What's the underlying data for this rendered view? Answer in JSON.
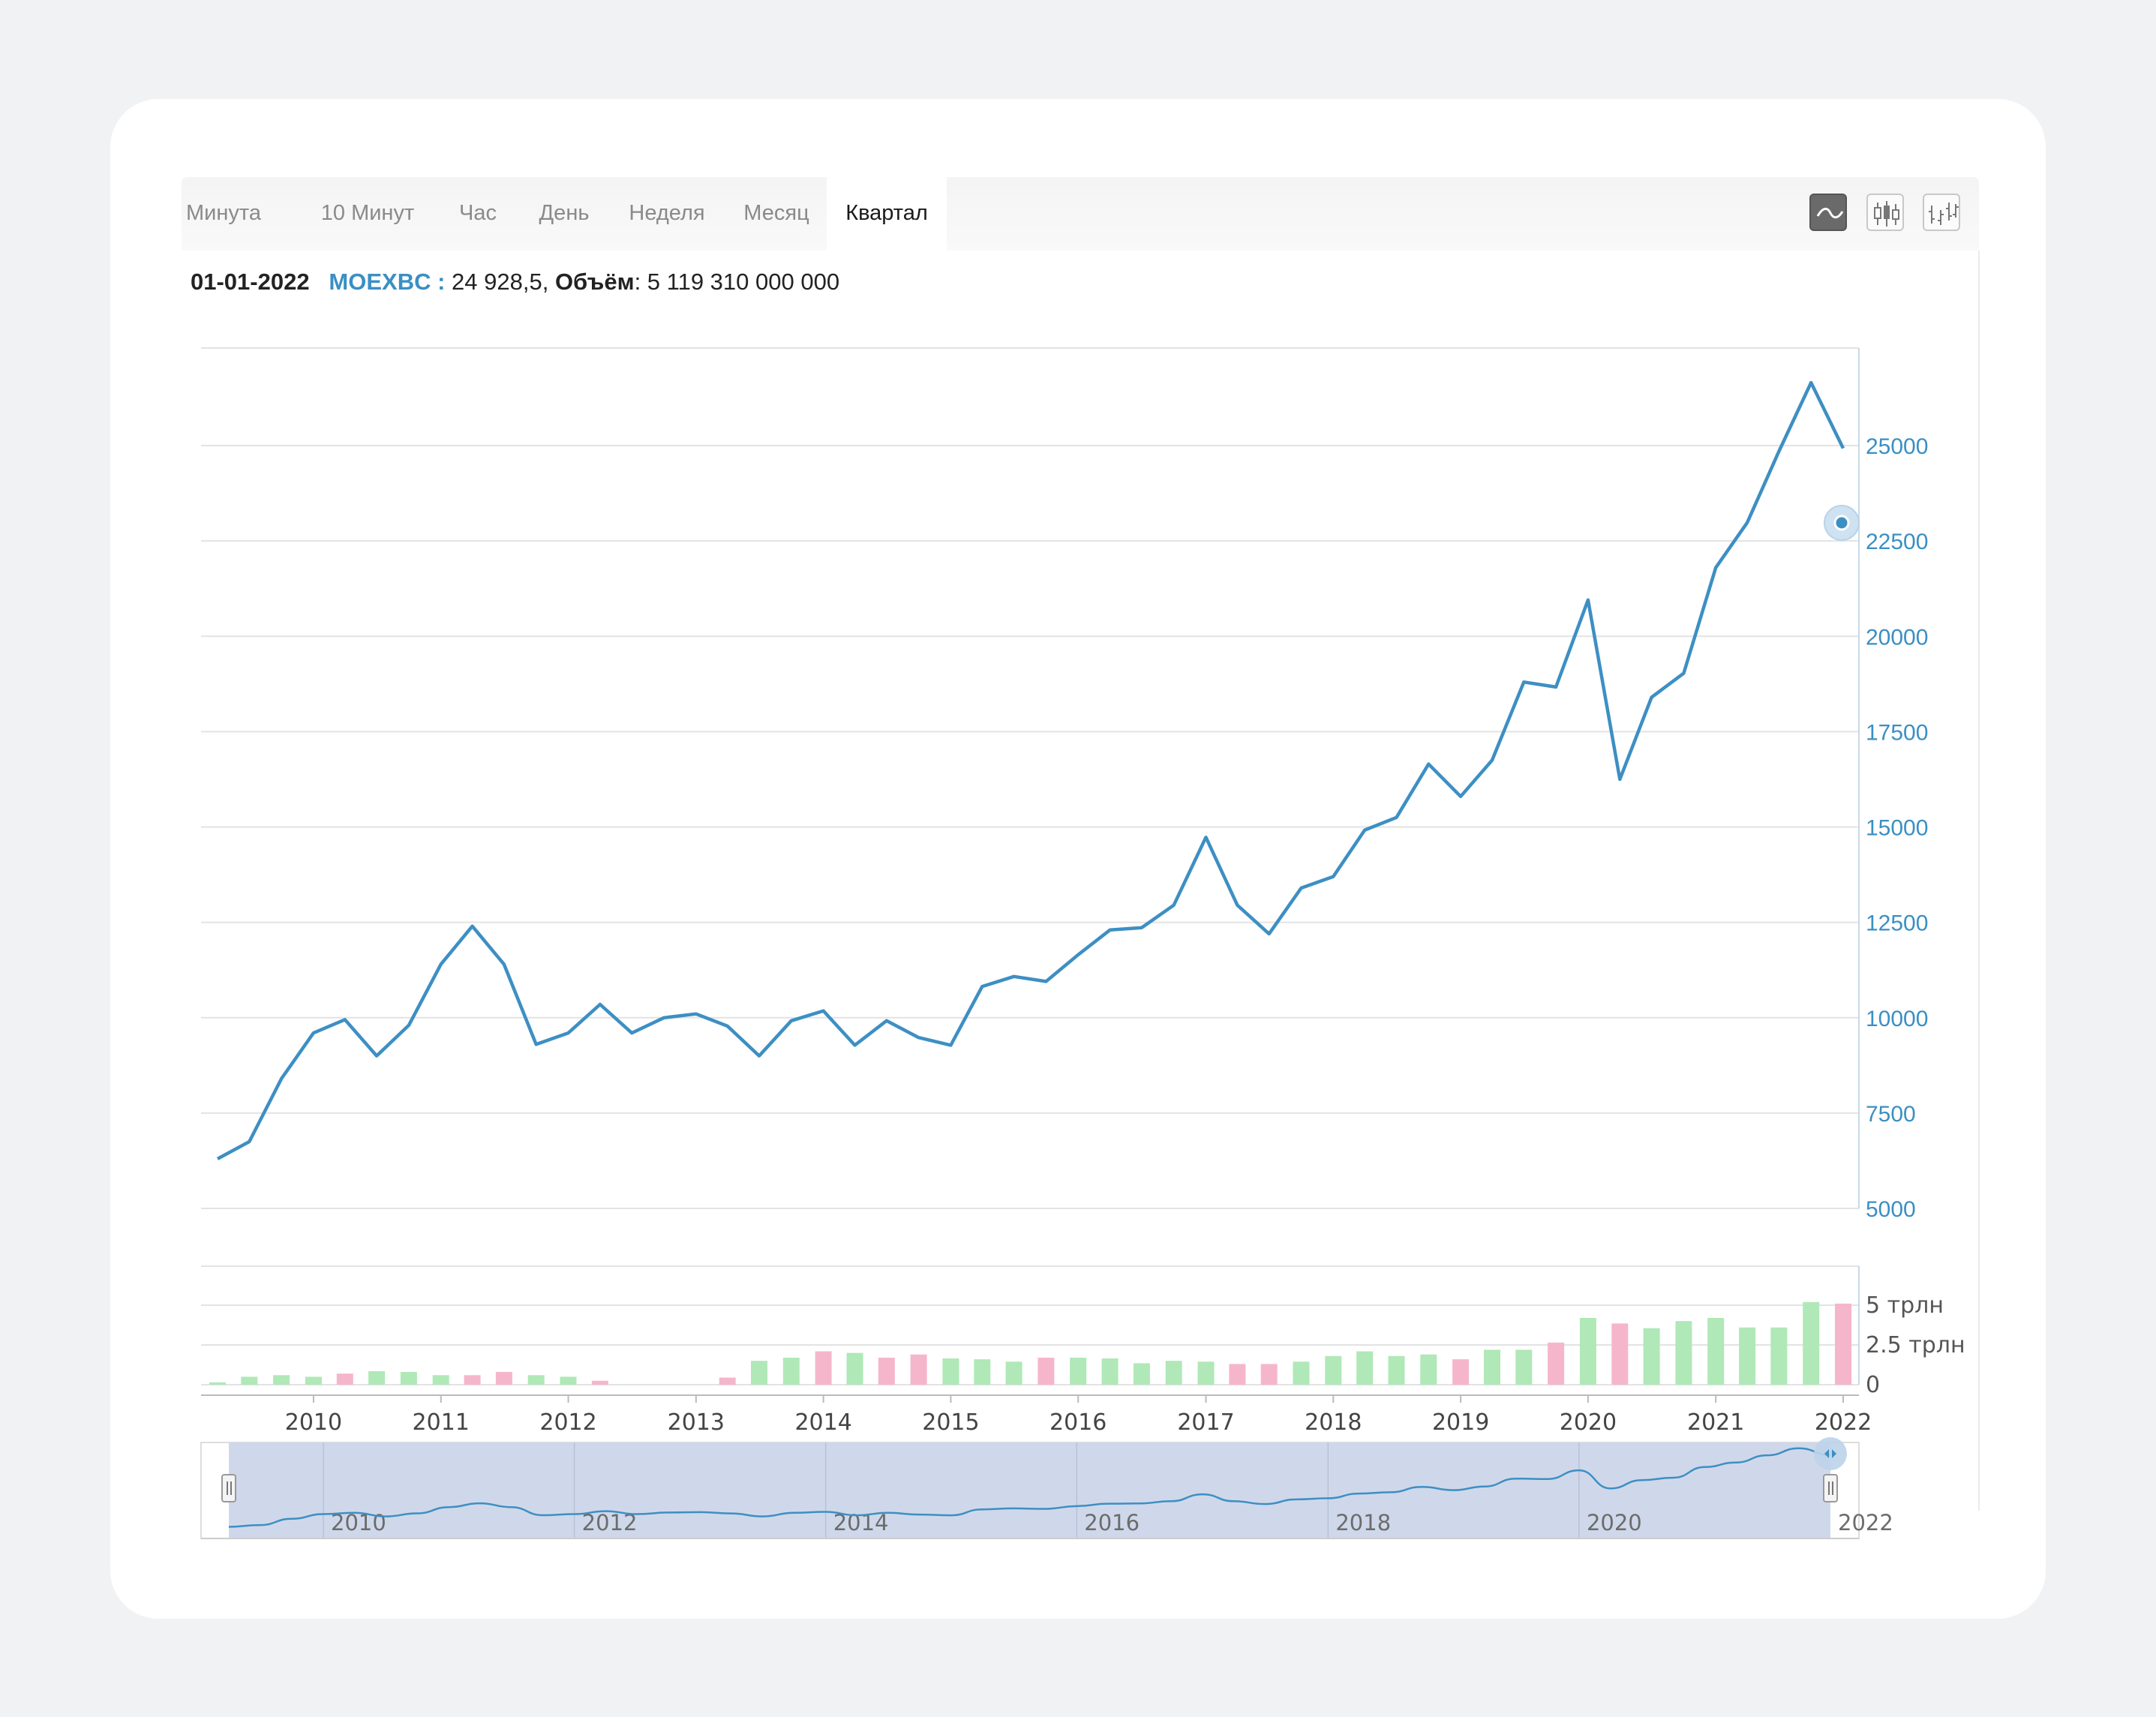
{
  "tabs": [
    {
      "label": "Минута"
    },
    {
      "label": "10 Минут"
    },
    {
      "label": "Час"
    },
    {
      "label": "День"
    },
    {
      "label": "Неделя"
    },
    {
      "label": "Месяц"
    },
    {
      "label": "Квартал"
    }
  ],
  "active_tab": "Квартал",
  "chart_types": [
    "line-chart-icon",
    "candlestick-icon",
    "ohlc-bars-icon"
  ],
  "info": {
    "date": "01-01-2022",
    "ticker": "MOEXBC :",
    "value": " 24 928,5, ",
    "volume_label": "Объём",
    "volume_value": ": 5 119 310 000 000"
  },
  "colors": {
    "line": "#3d8fc3",
    "volume_up": "#b0e8b8",
    "volume_down": "#f5b6cc",
    "navigator_fill": "#cfd8ea",
    "axis_label": "#3a8fc4"
  },
  "chart_data": [
    {
      "type": "line",
      "series": [
        {
          "x": [
            "2009-04-01",
            "2009-07-01",
            "2009-10-01",
            "2010-01-01",
            "2010-04-01",
            "2010-07-01",
            "2010-10-01",
            "2011-01-01",
            "2011-04-01",
            "2011-07-01",
            "2011-10-01",
            "2012-01-01",
            "2012-04-01",
            "2012-07-01",
            "2012-10-01",
            "2013-01-01",
            "2013-04-01",
            "2013-07-01",
            "2013-10-01",
            "2014-01-01",
            "2014-04-01",
            "2014-07-01",
            "2014-10-01",
            "2015-01-01",
            "2015-04-01",
            "2015-07-01",
            "2015-10-01",
            "2016-01-01",
            "2016-04-01",
            "2016-07-01",
            "2016-10-01",
            "2017-01-01",
            "2017-04-01",
            "2017-07-01",
            "2017-10-01",
            "2018-01-01",
            "2018-04-01",
            "2018-07-01",
            "2018-10-01",
            "2019-01-01",
            "2019-04-01",
            "2019-07-01",
            "2019-10-01",
            "2020-01-01",
            "2020-04-01",
            "2020-07-01",
            "2020-10-01",
            "2021-01-01",
            "2021-04-01",
            "2021-07-01",
            "2021-10-01",
            "2022-01-01"
          ],
          "values": [
            6300,
            6750,
            8400,
            9600,
            9950,
            9000,
            9800,
            11400,
            12400,
            11400,
            9300,
            9600,
            10350,
            9600,
            10000,
            10100,
            9780,
            9000,
            9920,
            10180,
            9280,
            9920,
            9480,
            9280,
            10820,
            11080,
            10950,
            11650,
            12300,
            12360,
            12950,
            14730,
            12950,
            12200,
            13400,
            13700,
            14920,
            15250,
            16650,
            15800,
            16750,
            18800,
            18670,
            20950,
            16250,
            18400,
            19030,
            21800,
            22980,
            24850,
            26650,
            24928.5
          ],
          "last_value_label": "24 928,5"
        }
      ],
      "ylim": [
        5000,
        27000
      ],
      "yticks": [
        "5000",
        "7500",
        "10000",
        "12500",
        "15000",
        "17500",
        "20000",
        "22500",
        "25000"
      ],
      "xticks": [
        "2010",
        "2011",
        "2012",
        "2013",
        "2014",
        "2015",
        "2016",
        "2017",
        "2018",
        "2019",
        "2020",
        "2021",
        "2022"
      ]
    },
    {
      "type": "bar",
      "name": "volume",
      "categories": [
        "2009-04",
        "2009-07",
        "2009-10",
        "2010-01",
        "2010-04",
        "2010-07",
        "2010-10",
        "2011-01",
        "2011-04",
        "2011-07",
        "2011-10",
        "2012-01",
        "2012-04",
        "2012-07",
        "2012-10",
        "2013-01",
        "2013-04",
        "2013-07",
        "2013-10",
        "2014-01",
        "2014-04",
        "2014-07",
        "2014-10",
        "2015-01",
        "2015-04",
        "2015-07",
        "2015-10",
        "2016-01",
        "2016-04",
        "2016-07",
        "2016-10",
        "2017-01",
        "2017-04",
        "2017-07",
        "2017-10",
        "2018-01",
        "2018-04",
        "2018-07",
        "2018-10",
        "2019-01",
        "2019-04",
        "2019-07",
        "2019-10",
        "2020-01",
        "2020-04",
        "2020-07",
        "2020-10",
        "2021-01",
        "2021-04",
        "2021-07",
        "2021-10",
        "2022-01"
      ],
      "values": [
        0.15,
        0.5,
        0.6,
        0.5,
        0.7,
        0.85,
        0.8,
        0.6,
        0.6,
        0.8,
        0.6,
        0.5,
        0.25,
        0,
        0,
        0,
        0.45,
        1.5,
        1.7,
        2.1,
        2.0,
        1.7,
        1.9,
        1.65,
        1.6,
        1.45,
        1.7,
        1.7,
        1.65,
        1.35,
        1.5,
        1.45,
        1.3,
        1.3,
        1.45,
        1.8,
        2.1,
        1.8,
        1.9,
        1.6,
        2.2,
        2.2,
        2.65,
        4.2,
        3.85,
        3.55,
        4.0,
        4.2,
        3.6,
        3.6,
        5.2,
        5.1
      ],
      "direction": [
        "up",
        "up",
        "up",
        "up",
        "down",
        "up",
        "up",
        "up",
        "down",
        "down",
        "up",
        "up",
        "down",
        "up",
        "up",
        "up",
        "down",
        "up",
        "up",
        "down",
        "up",
        "down",
        "down",
        "up",
        "up",
        "up",
        "down",
        "up",
        "up",
        "up",
        "up",
        "up",
        "down",
        "down",
        "up",
        "up",
        "up",
        "up",
        "up",
        "down",
        "up",
        "up",
        "down",
        "up",
        "down",
        "up",
        "up",
        "up",
        "up",
        "up",
        "up",
        "down"
      ],
      "unit": "трлн",
      "ylim": [
        0,
        6
      ],
      "yticks": [
        "0",
        "2.5 трлн",
        "5 трлн"
      ]
    },
    {
      "type": "area",
      "name": "navigator",
      "xticks": [
        "2010",
        "2012",
        "2014",
        "2016",
        "2018",
        "2020",
        "2022"
      ]
    }
  ]
}
